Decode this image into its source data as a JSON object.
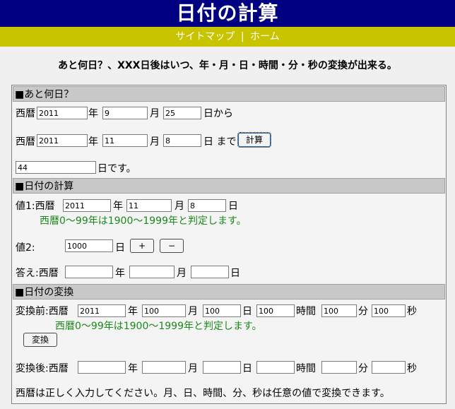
{
  "header": {
    "title": "日付の計算"
  },
  "nav": {
    "sitemap": "サイトマップ",
    "separator": "|",
    "home": "ホーム"
  },
  "intro": "あと何日？、XXX日後はいつ、年・月・日・時間・分・秒の変換が出来る。",
  "sec1": {
    "title": "■あと何日？",
    "seireki": "西暦",
    "nen": "年",
    "tsuki": "月",
    "from_suffix": "日から",
    "to_suffix": "日 まで",
    "calc_btn": "計算",
    "result_suffix": "日です。",
    "from_year": "2011",
    "from_month": "9",
    "from_day": "25",
    "to_year": "2011",
    "to_month": "11",
    "to_day": "8",
    "result": "44"
  },
  "sec2": {
    "title": "■日付の計算",
    "val1_label": "値1:西暦",
    "nen": "年",
    "tsuki": "月",
    "hi": "日",
    "note": "西暦0〜99年は1900〜1999年と判定します。",
    "val2_label": "値2:",
    "val2_days": "1000",
    "plus_btn": "+",
    "minus_btn": "−",
    "answer_label": "答え:西暦",
    "v1_year": "2011",
    "v1_month": "11",
    "v1_day": "8"
  },
  "sec3": {
    "title": "■日付の変換",
    "before_label": "変換前:西暦",
    "after_label": "変換後:西暦",
    "nen": "年",
    "tsuki": "月",
    "hi": "日",
    "jikan": "時間",
    "fun": "分",
    "byou": "秒",
    "note": "西暦0〜99年は1900〜1999年と判定します。",
    "convert_btn": "変換",
    "b_year": "2011",
    "b_month": "100",
    "b_day": "100",
    "b_hour": "100",
    "b_min": "100",
    "b_sec": "100",
    "footer_note": "西暦は正しく入力してください。月、日、時間、分、秒は任意の値で変換できます。"
  }
}
